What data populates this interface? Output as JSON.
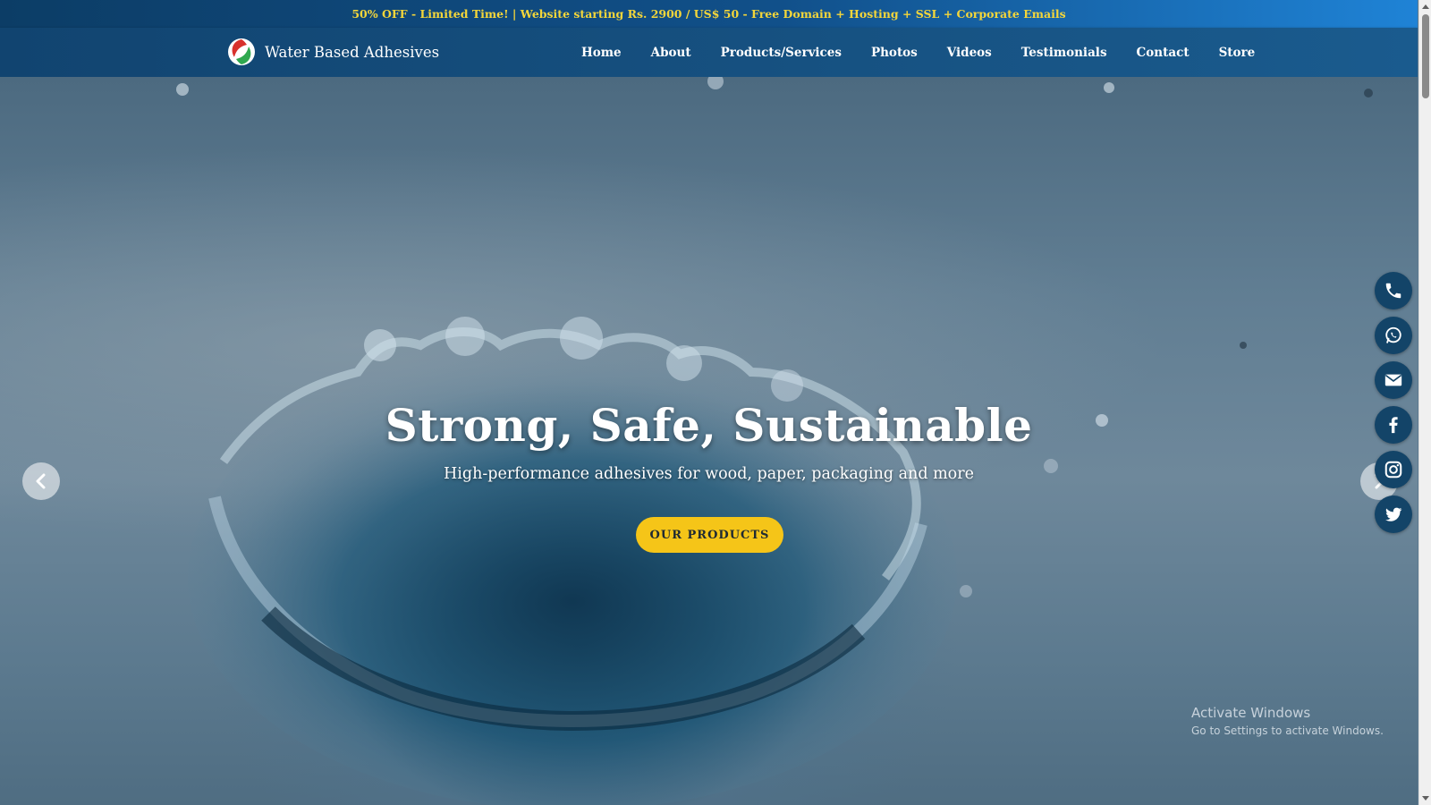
{
  "promo_bar": {
    "text": "50% OFF - Limited Time! | Website starting Rs. 2900 / US$ 50 - Free Domain + Hosting + SSL + Corporate Emails",
    "text_color": "#f4d63a"
  },
  "header": {
    "brand_name": "Water Based Adhesives",
    "logo_icon": "red-green-leaf-logo",
    "nav_items": [
      {
        "label": "Home"
      },
      {
        "label": "About"
      },
      {
        "label": "Products/Services"
      },
      {
        "label": "Photos"
      },
      {
        "label": "Videos"
      },
      {
        "label": "Testimonials"
      },
      {
        "label": "Contact"
      },
      {
        "label": "Store"
      }
    ],
    "background": "#134a78"
  },
  "hero": {
    "title": "Strong, Safe, Sustainable",
    "subtitle": "High-performance adhesives for wood, paper, packaging and more",
    "cta_label": "OUR PRODUCTS",
    "cta_color": "#f5c518",
    "prev_icon": "chevron-left-icon",
    "next_icon": "chevron-right-icon"
  },
  "social_links": [
    {
      "name": "phone",
      "icon": "phone-icon"
    },
    {
      "name": "whatsapp",
      "icon": "whatsapp-icon"
    },
    {
      "name": "email",
      "icon": "envelope-icon"
    },
    {
      "name": "facebook",
      "icon": "facebook-icon"
    },
    {
      "name": "instagram",
      "icon": "instagram-icon"
    },
    {
      "name": "twitter",
      "icon": "twitter-icon"
    }
  ],
  "watermark": {
    "title": "Activate Windows",
    "subtitle": "Go to Settings to activate Windows."
  }
}
